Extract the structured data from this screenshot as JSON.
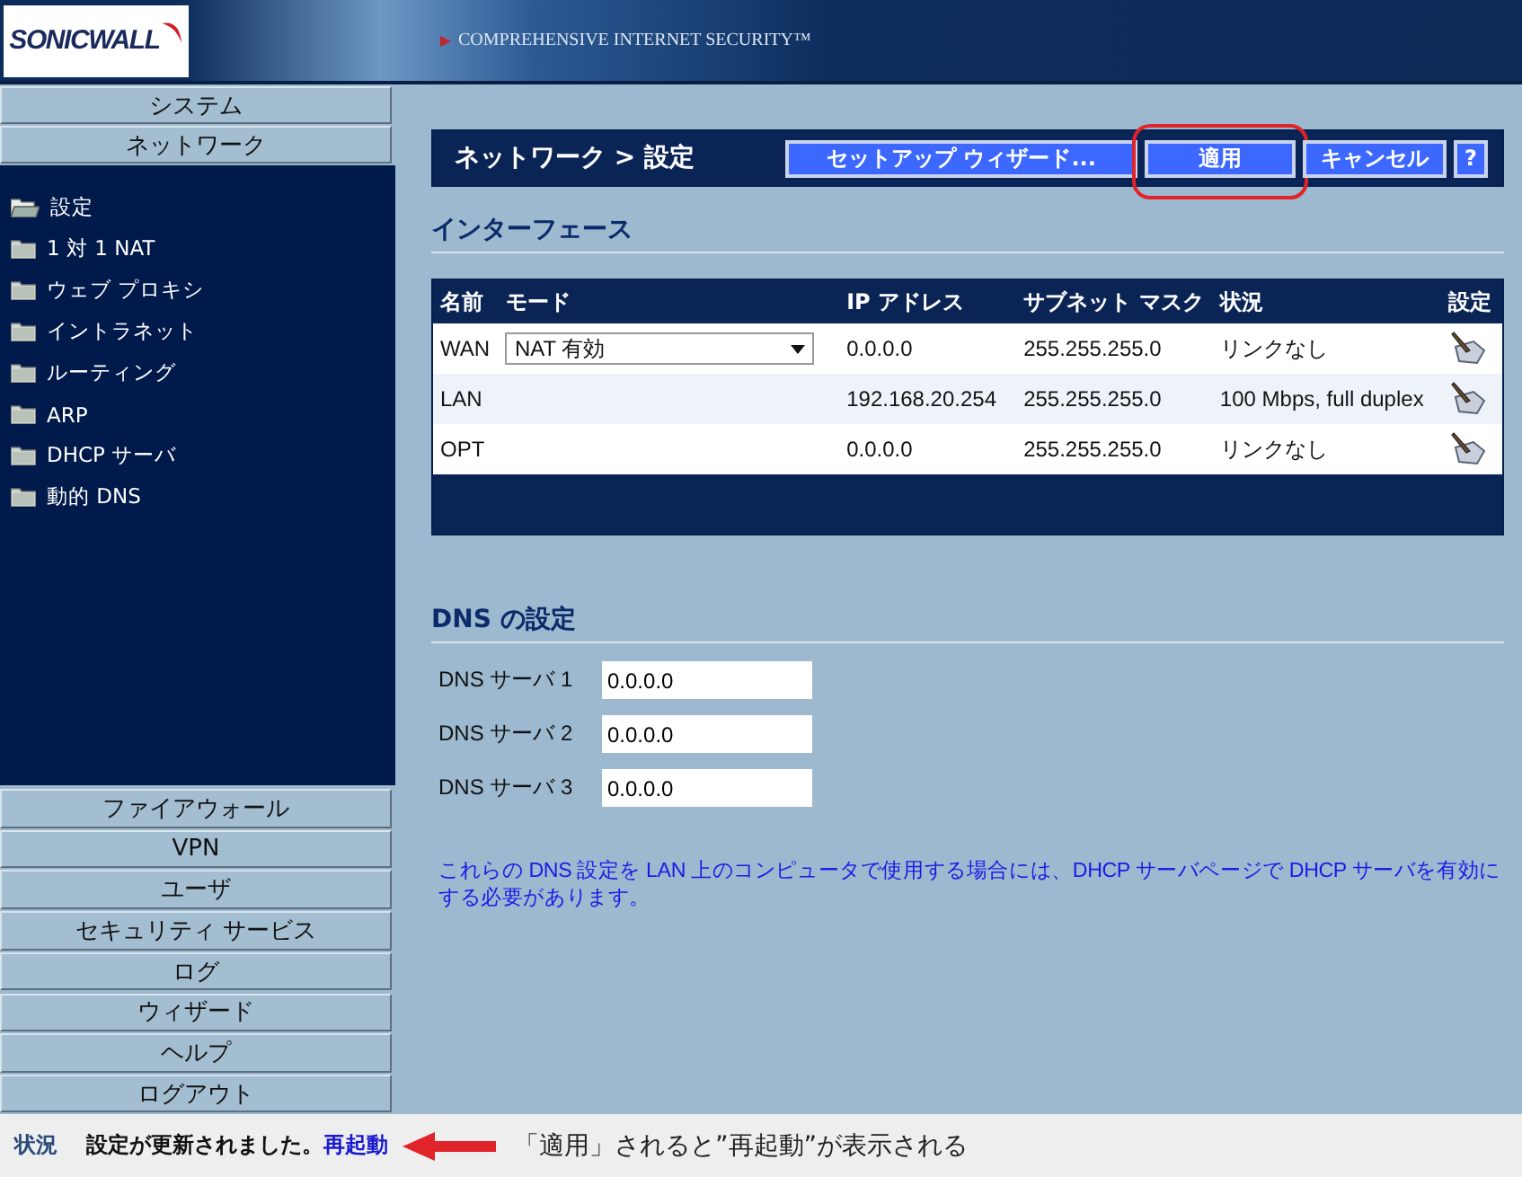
{
  "header": {
    "logo": "SONICWALL",
    "tagline": "COMPREHENSIVE INTERNET SECURITY™"
  },
  "sidebar": {
    "top_items": [
      "システム",
      "ネットワーク"
    ],
    "sub_items": [
      {
        "label": "設定",
        "selected": true
      },
      {
        "label": "1 対 1 NAT",
        "selected": false
      },
      {
        "label": "ウェブ プロキシ",
        "selected": false
      },
      {
        "label": "イントラネット",
        "selected": false
      },
      {
        "label": "ルーティング",
        "selected": false
      },
      {
        "label": "ARP",
        "selected": false
      },
      {
        "label": "DHCP サーバ",
        "selected": false
      },
      {
        "label": "動的 DNS",
        "selected": false
      }
    ],
    "bottom_items": [
      "ファイアウォール",
      "VPN",
      "ユーザ",
      "セキュリティ サービス",
      "ログ",
      "ウィザード",
      "ヘルプ",
      "ログアウト"
    ]
  },
  "page": {
    "title": "ネットワーク > 設定",
    "buttons": [
      {
        "label": "セットアップ ウィザード...",
        "highlighted": false
      },
      {
        "label": "適用",
        "highlighted": true
      },
      {
        "label": "キャンセル",
        "highlighted": false
      },
      {
        "label": "?",
        "highlighted": false
      }
    ]
  },
  "interfaces": {
    "title": "インターフェース",
    "columns": [
      "名前",
      "モード",
      "IP アドレス",
      "サブネット マスク",
      "状況",
      "設定"
    ],
    "rows": [
      {
        "name": "WAN",
        "mode": "NAT 有効",
        "ip": "0.0.0.0",
        "mask": "255.255.255.0",
        "status": "リンクなし"
      },
      {
        "name": "LAN",
        "ip": "192.168.20.254",
        "mask": "255.255.255.0",
        "status": "100 Mbps, full duplex"
      },
      {
        "name": "OPT",
        "ip": "0.0.0.0",
        "mask": "255.255.255.0",
        "status": "リンクなし"
      }
    ]
  },
  "dns": {
    "title": "DNS の設定",
    "fields": [
      {
        "label": "DNS サーバ 1",
        "value": "0.0.0.0"
      },
      {
        "label": "DNS サーバ 2",
        "value": "0.0.0.0"
      },
      {
        "label": "DNS サーバ 3",
        "value": "0.0.0.0"
      }
    ],
    "note": "これらの DNS 設定を LAN 上のコンピュータで使用する場合には、DHCP サーバページで DHCP サーバを有効にする必要があります。"
  },
  "status_bar": {
    "label": "状況",
    "message": "設定が更新されました。",
    "link": "再起動",
    "annotation": "「適用」されると”再起動”が表示される"
  }
}
